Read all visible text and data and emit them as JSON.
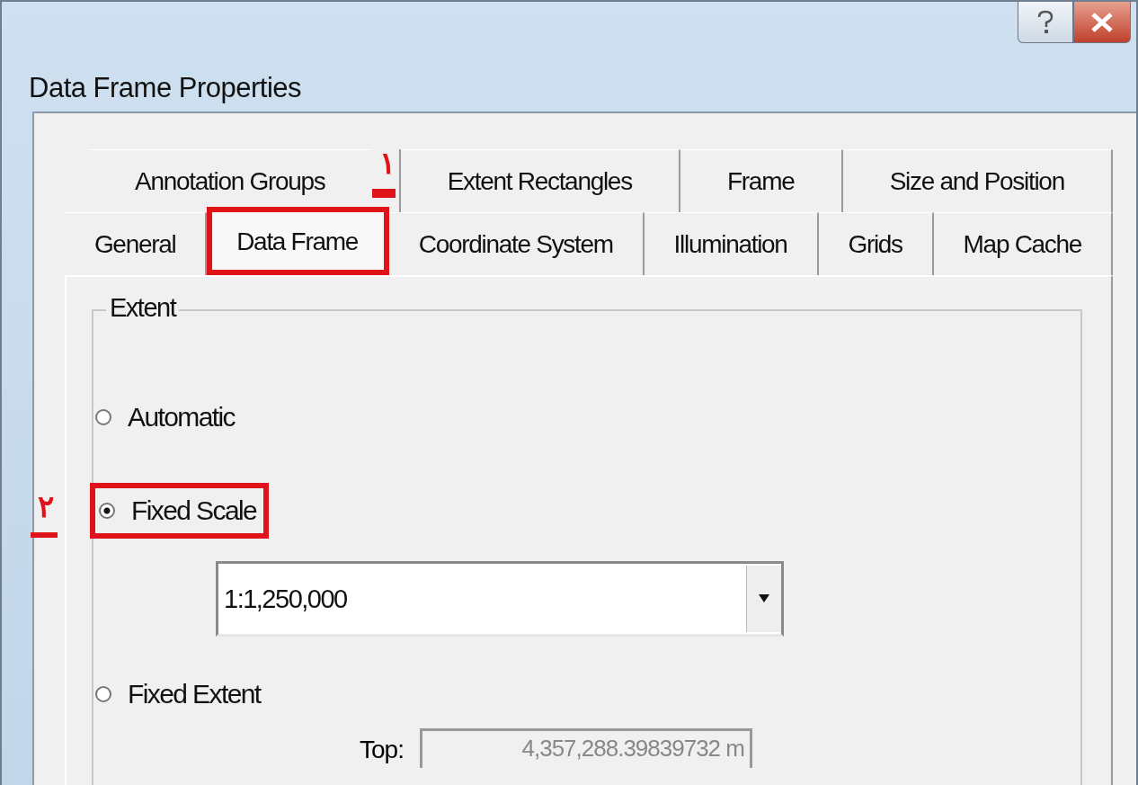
{
  "window": {
    "title": "Data Frame Properties"
  },
  "tab_rows": [
    [
      {
        "label": "Annotation Groups",
        "selected": false,
        "highlighted": false
      },
      {
        "label": "Extent Rectangles",
        "selected": false,
        "highlighted": false
      },
      {
        "label": "Frame",
        "selected": false,
        "highlighted": false
      },
      {
        "label": "Size and Position",
        "selected": false,
        "highlighted": false
      }
    ],
    [
      {
        "label": "General",
        "selected": false,
        "highlighted": false
      },
      {
        "label": "Data Frame",
        "selected": true,
        "highlighted": true,
        "callout": "١"
      },
      {
        "label": "Coordinate System",
        "selected": false,
        "highlighted": false
      },
      {
        "label": "Illumination",
        "selected": false,
        "highlighted": false
      },
      {
        "label": "Grids",
        "selected": false,
        "highlighted": false
      },
      {
        "label": "Map Cache",
        "selected": false,
        "highlighted": false
      }
    ]
  ],
  "extent": {
    "title": "Extent",
    "options": [
      {
        "label": "Automatic",
        "selected": false,
        "highlighted": false
      },
      {
        "label": "Fixed Scale",
        "selected": true,
        "highlighted": true,
        "callout": "٢",
        "combo_value": "1:1,250,000"
      },
      {
        "label": "Fixed Extent",
        "selected": false,
        "highlighted": false,
        "fields": [
          {
            "label": "Top:",
            "value": "4,357,288.39839732 m",
            "disabled": true
          }
        ]
      }
    ]
  }
}
